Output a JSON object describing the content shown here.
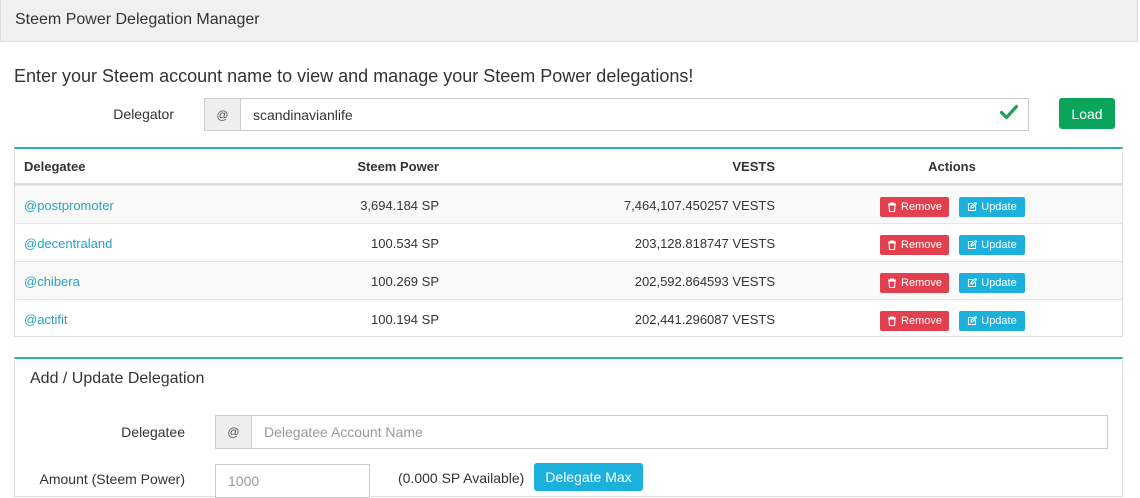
{
  "header": {
    "title": "Steem Power Delegation Manager"
  },
  "intro": "Enter your Steem account name to view and manage your Steem Power delegations!",
  "delegator": {
    "label": "Delegator",
    "prefix": "@",
    "value": "scandinavianlife",
    "valid_icon": "check-icon",
    "load_label": "Load"
  },
  "table": {
    "headers": [
      "Delegatee",
      "Steem Power",
      "VESTS",
      "Actions"
    ],
    "rows": [
      {
        "delegatee": "@postpromoter",
        "sp": "3,694.184 SP",
        "vests": "7,464,107.450257 VESTS"
      },
      {
        "delegatee": "@decentraland",
        "sp": "100.534 SP",
        "vests": "203,128.818747 VESTS"
      },
      {
        "delegatee": "@chibera",
        "sp": "100.269 SP",
        "vests": "202,592.864593 VESTS"
      },
      {
        "delegatee": "@actifit",
        "sp": "100.194 SP",
        "vests": "202,441.296087 VESTS"
      }
    ],
    "remove_label": "Remove",
    "update_label": "Update",
    "remove_icon": "trash-icon",
    "update_icon": "edit-icon"
  },
  "add_update": {
    "title": "Add / Update Delegation",
    "delegatee_label": "Delegatee",
    "delegatee_prefix": "@",
    "delegatee_placeholder": "Delegatee Account Name",
    "amount_label": "Amount (Steem Power)",
    "amount_placeholder": "1000",
    "available": "(0.000 SP Available)",
    "max_label": "Delegate Max"
  },
  "colors": {
    "accent_green": "#0aa55a",
    "remove_red": "#e2404f",
    "update_blue": "#1cb1dc",
    "link": "#2aa1c0",
    "panel_border_top": "#2ab5a5"
  }
}
